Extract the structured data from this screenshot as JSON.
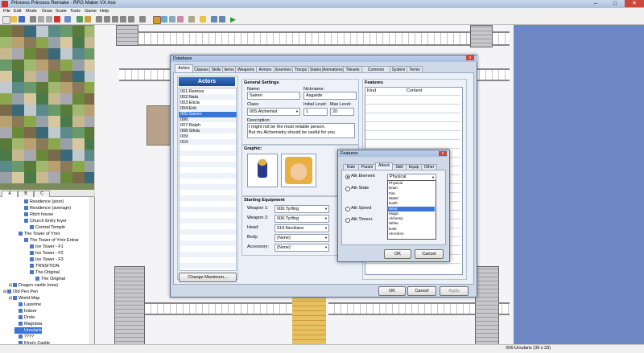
{
  "window": {
    "title": "Princess Princess Remake - RPG Maker VX Ace",
    "min": "–",
    "max": "□",
    "close": "✕"
  },
  "menu": [
    "File",
    "Edit",
    "Mode",
    "Draw",
    "Scale",
    "Tools",
    "Game",
    "Help"
  ],
  "tileset_tabs": [
    "A",
    "B",
    "C"
  ],
  "tree": [
    {
      "label": "Residence (poor)",
      "level": 3
    },
    {
      "label": "Residence (average)",
      "level": 3
    },
    {
      "label": "Ritch house",
      "level": 3
    },
    {
      "label": "Church Entry foyer",
      "level": 3
    },
    {
      "label": "Central Temple",
      "level": 4
    },
    {
      "label": "The Tower of Ymir",
      "level": 2
    },
    {
      "label": "The Tower of Ymir Entrar",
      "level": 3
    },
    {
      "label": "Ice Tower - F1",
      "level": 4
    },
    {
      "label": "Ice Tower - F2",
      "level": 4
    },
    {
      "label": "Ice Tower - F3",
      "level": 4
    },
    {
      "label": "TRNSITION",
      "level": 4
    },
    {
      "label": "The Original",
      "level": 4
    },
    {
      "label": "The Original",
      "level": 5
    },
    {
      "label": "Dragon castle (new)",
      "level": 1
    },
    {
      "label": "Old Pen Pen",
      "level": 0
    },
    {
      "label": "World Map",
      "level": 1
    },
    {
      "label": "Lazerine",
      "level": 2
    },
    {
      "label": "Indoor",
      "level": 2
    },
    {
      "label": "Drole",
      "level": 2
    },
    {
      "label": "Magnisia",
      "level": 2
    },
    {
      "label": "Ursularis",
      "level": 2,
      "selected": true
    },
    {
      "label": "????",
      "level": 2
    },
    {
      "label": "King's Castle",
      "level": 2
    }
  ],
  "status": "006:Ursularis (39 x 33)",
  "database": {
    "title": "Database",
    "close": "x",
    "tabs": [
      "Actors",
      "Classes",
      "Skills",
      "Items",
      "Weapons",
      "Armors",
      "Enemies",
      "Troops",
      "States",
      "Animations",
      "Tilesets",
      "Common Events",
      "System",
      "Terms"
    ],
    "actors_header": "Actors",
    "actors": [
      "001:Ramius",
      "002:Nala",
      "003:Elicia",
      "004:Erik",
      "005:Sairen",
      "006:",
      "007:Ralph",
      "008:Silvia",
      "009:",
      "010:"
    ],
    "selected_actor": 4,
    "change_max": "Change Maximum...",
    "general_settings": "General Settings",
    "name_label": "Name:",
    "name_value": "Sairen",
    "nickname_label": "Nickname:",
    "nickname_value": "Asgarde",
    "class_label": "Class:",
    "class_value": "005:Alchemist",
    "initial_level_label": "Initial Level:",
    "initial_level_value": "1",
    "max_level_label": "Max Level:",
    "max_level_value": "20",
    "description_label": "Description:",
    "description_line1": "I might not be the most reliable person.",
    "description_line2": "But my Alchemistry should be useful for you.",
    "graphic_label": "Graphic:",
    "starting_equipment": "Starting Equipment",
    "equipment": [
      {
        "slot": "Weapon 1:",
        "value": "006:Tyrfing"
      },
      {
        "slot": "Weapon 2:",
        "value": "006:Tyrfing"
      },
      {
        "slot": "Head:",
        "value": "010:Necklace"
      },
      {
        "slot": "Body:",
        "value": "(None)"
      },
      {
        "slot": "Accessory:",
        "value": "(None)"
      }
    ],
    "features_label": "Features",
    "features_cols": [
      "Kind",
      "Content"
    ],
    "ok": "OK",
    "cancel": "Cancel",
    "apply": "Apply"
  },
  "features_dialog": {
    "title": "Features",
    "close": "x",
    "tabs": [
      "Rate",
      "Param",
      "Attack",
      "Skill",
      "Equip",
      "Other"
    ],
    "active_tab": 2,
    "options": [
      "Atk Element",
      "Atk State",
      "Atk Speed",
      "Atk Times+"
    ],
    "element_value": "Physical",
    "dropdown": [
      "Physical",
      "Drain",
      "Fire",
      "Water",
      "Earth",
      "Wind",
      "Magic",
      "Alchemy",
      "White",
      "Dark",
      "AKASHA"
    ],
    "dropdown_selected": 5,
    "ok": "OK",
    "cancel": "Cancel"
  }
}
